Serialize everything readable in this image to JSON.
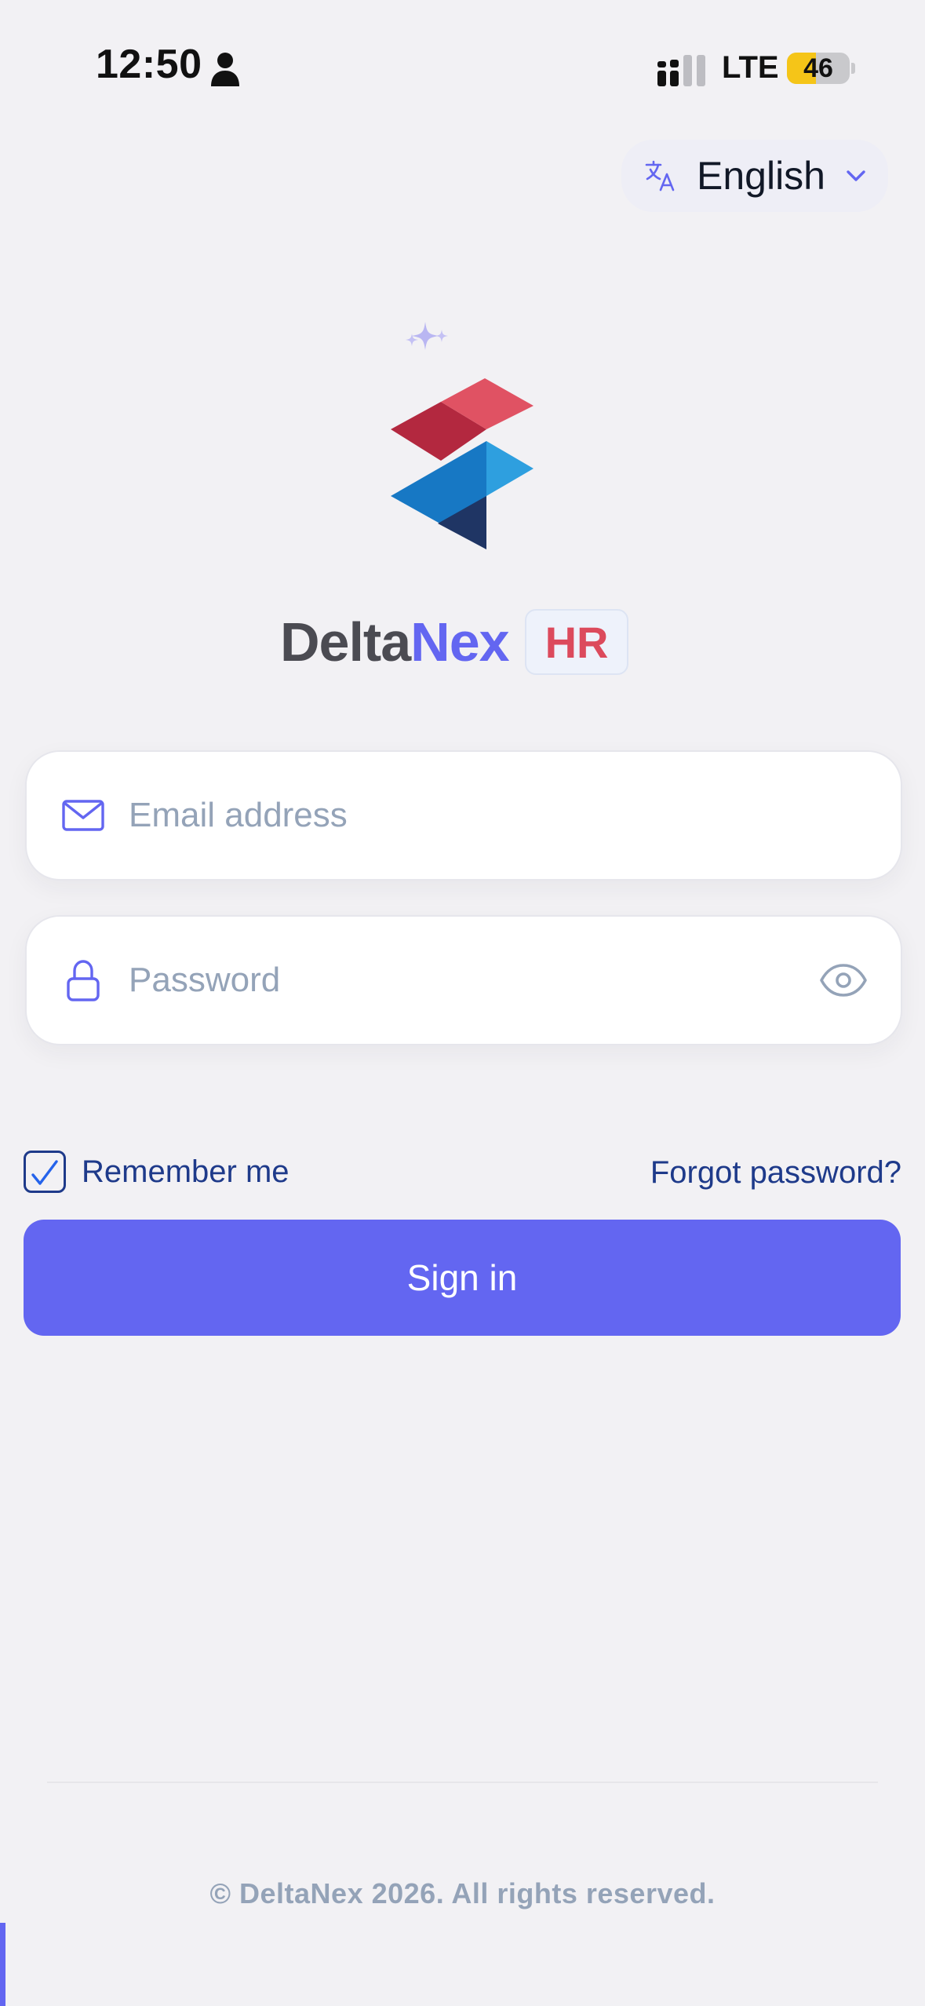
{
  "status_bar": {
    "time": "12:50",
    "network": "LTE",
    "battery": "46",
    "battery_level": 0.46
  },
  "language": {
    "icon": "translate-icon",
    "label": "English",
    "chevron": "chevron-down-icon"
  },
  "brand": {
    "name_part1": "Delta",
    "name_part2": "Nex",
    "badge": "HR",
    "colors": {
      "primary": "#6366f1",
      "badge_text": "#dc4a5c",
      "dark": "#4b4b52"
    }
  },
  "form": {
    "email": {
      "placeholder": "Email address",
      "value": "",
      "icon": "mail-icon"
    },
    "password": {
      "placeholder": "Password",
      "value": "",
      "icon": "lock-icon",
      "toggle_icon": "eye-icon"
    },
    "remember_label": "Remember me",
    "remember_checked": true,
    "forgot_label": "Forgot password?",
    "submit_label": "Sign in"
  },
  "footer": {
    "copyright": "© DeltaNex 2026. All rights reserved."
  }
}
